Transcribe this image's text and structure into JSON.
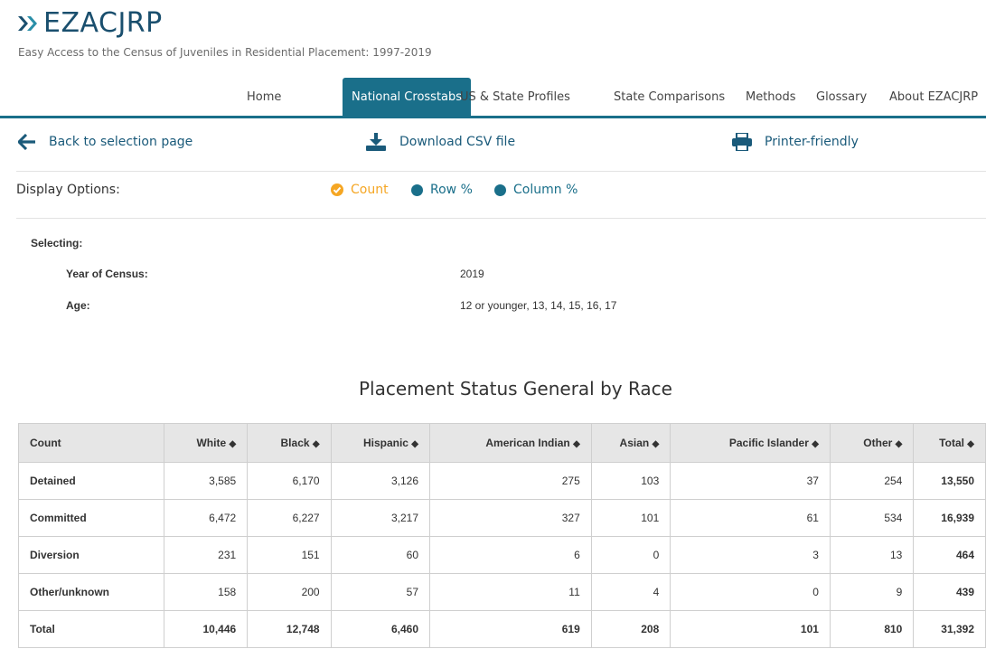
{
  "brand": {
    "logo_text": "EZACJRP",
    "subtitle": "Easy Access to the Census of Juveniles in Residential Placement: 1997-2019"
  },
  "nav": {
    "home": "Home",
    "national_crosstabs": "National Crosstabs",
    "us_state_profiles": "US & State Profiles",
    "state_comparisons": "State Comparisons",
    "methods": "Methods",
    "glossary": "Glossary",
    "about": "About EZACJRP"
  },
  "actions": {
    "back": "Back to selection page",
    "download": "Download CSV file",
    "print": "Printer-friendly"
  },
  "display_options": {
    "label": "Display Options:",
    "count": "Count",
    "row_pct": "Row %",
    "col_pct": "Column %",
    "selected": "Count"
  },
  "selecting": {
    "heading": "Selecting:",
    "year_label": "Year of Census:",
    "year_value": "2019",
    "age_label": "Age:",
    "age_value": "12 or younger, 13, 14, 15, 16, 17"
  },
  "table": {
    "title": "Placement Status General by Race",
    "headers": [
      "Count",
      "White",
      "Black",
      "Hispanic",
      "American Indian",
      "Asian",
      "Pacific Islander",
      "Other",
      "Total"
    ],
    "rows": [
      [
        "Detained",
        "3,585",
        "6,170",
        "3,126",
        "275",
        "103",
        "37",
        "254",
        "13,550"
      ],
      [
        "Committed",
        "6,472",
        "6,227",
        "3,217",
        "327",
        "101",
        "61",
        "534",
        "16,939"
      ],
      [
        "Diversion",
        "231",
        "151",
        "60",
        "6",
        "0",
        "3",
        "13",
        "464"
      ],
      [
        "Other/unknown",
        "158",
        "200",
        "57",
        "11",
        "4",
        "0",
        "9",
        "439"
      ],
      [
        "Total",
        "10,446",
        "12,748",
        "6,460",
        "619",
        "208",
        "101",
        "810",
        "31,392"
      ]
    ]
  },
  "colors": {
    "primary": "#1a6f8a",
    "selected_option": "#f5a623",
    "logo": "#1a4f6e"
  },
  "icons": {
    "back": "arrow-left-icon",
    "download": "download-icon",
    "print": "printer-icon",
    "sort": "sort-icon"
  }
}
